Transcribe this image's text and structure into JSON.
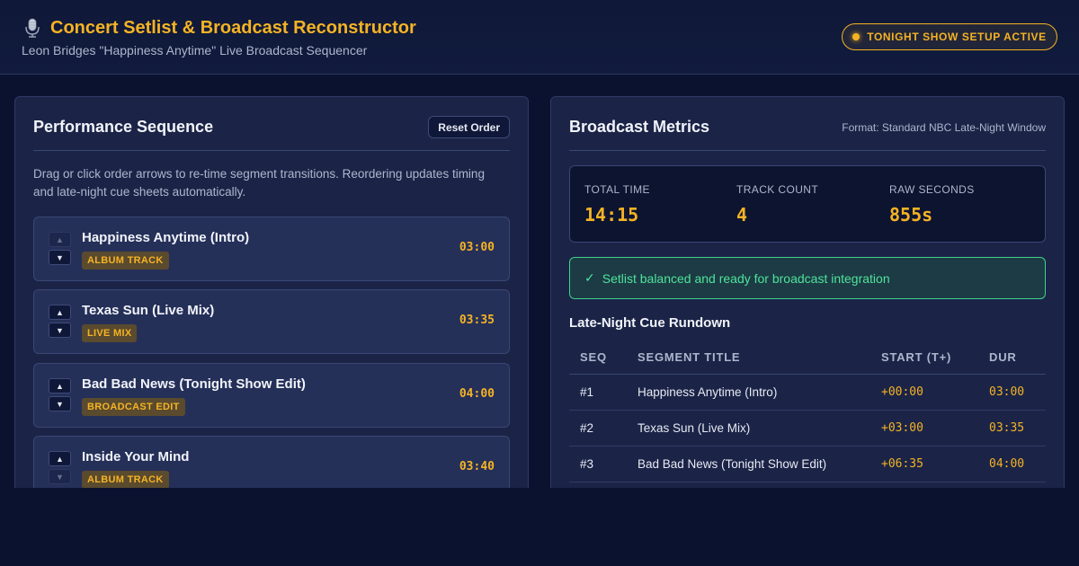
{
  "header": {
    "icon": "microphone-icon",
    "title": "Concert Setlist & Broadcast Reconstructor",
    "subtitle": "Leon Bridges \"Happiness Anytime\" Live Broadcast Sequencer",
    "status": "TONIGHT SHOW SETUP ACTIVE"
  },
  "sequence": {
    "title": "Performance Sequence",
    "reset_label": "Reset Order",
    "instructions": "Drag or click order arrows to re-time segment transitions. Reordering updates timing and late-night cue sheets automatically.",
    "up_glyph": "▲",
    "down_glyph": "▼",
    "tracks": [
      {
        "title": "Happiness Anytime (Intro)",
        "tag": "ALBUM TRACK",
        "duration": "03:00"
      },
      {
        "title": "Texas Sun (Live Mix)",
        "tag": "LIVE MIX",
        "duration": "03:35"
      },
      {
        "title": "Bad Bad News (Tonight Show Edit)",
        "tag": "BROADCAST EDIT",
        "duration": "04:00"
      },
      {
        "title": "Inside Your Mind",
        "tag": "ALBUM TRACK",
        "duration": "03:40"
      }
    ]
  },
  "metrics": {
    "title": "Broadcast Metrics",
    "format": "Format: Standard NBC Late-Night Window",
    "total_time_label": "TOTAL TIME",
    "total_time": "14:15",
    "track_count_label": "TRACK COUNT",
    "track_count": "4",
    "raw_seconds_label": "RAW SECONDS",
    "raw_seconds": "855s",
    "success_icon": "✓",
    "success_message": "Setlist balanced and ready for broadcast integration",
    "rundown_title": "Late-Night Cue Rundown",
    "columns": [
      "SEQ",
      "SEGMENT TITLE",
      "START (T+)",
      "DUR"
    ],
    "rows": [
      {
        "seq": "#1",
        "title": "Happiness Anytime (Intro)",
        "start": "+00:00",
        "dur": "03:00"
      },
      {
        "seq": "#2",
        "title": "Texas Sun (Live Mix)",
        "start": "+03:00",
        "dur": "03:35"
      },
      {
        "seq": "#3",
        "title": "Bad Bad News (Tonight Show Edit)",
        "start": "+06:35",
        "dur": "04:00"
      }
    ]
  },
  "colors": {
    "accent": "#f5b324",
    "background": "#0b1230",
    "panel": "#1b2447",
    "success": "#4fe39a"
  }
}
